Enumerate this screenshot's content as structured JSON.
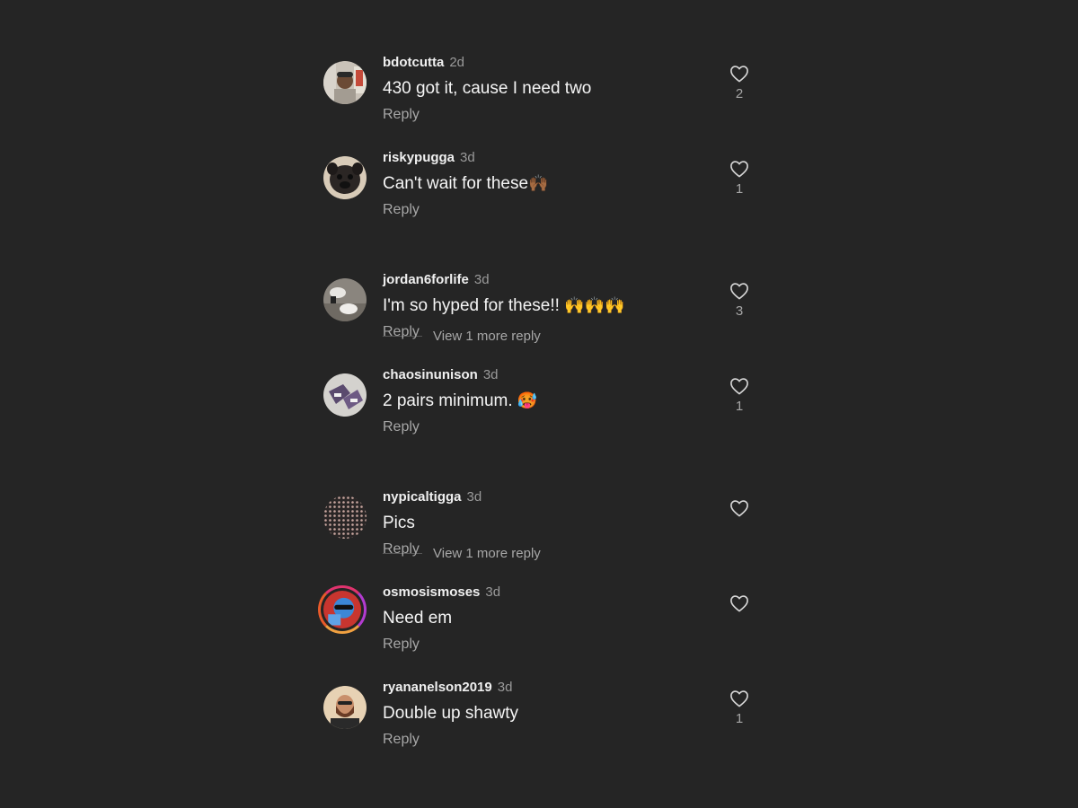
{
  "comments": [
    {
      "username": "bdotcutta",
      "time": "2d",
      "text": "430 got it, cause I need two",
      "reply": "Reply",
      "likes": "2"
    },
    {
      "username": "riskypugga",
      "time": "3d",
      "text": "Can't wait for these",
      "emoji": "🙌🏾",
      "reply": "Reply",
      "likes": "1",
      "more_replies": "View 1 more reply"
    },
    {
      "username": "jordan6forlife",
      "time": "3d",
      "text": "I'm so hyped for these!! ",
      "emoji": "🙌🙌🙌",
      "reply": "Reply",
      "likes": "3"
    },
    {
      "username": "chaosinunison",
      "time": "3d",
      "text": "2 pairs minimum. ",
      "emoji": "🥵",
      "reply": "Reply",
      "likes": "1",
      "more_replies": "View 1 more reply"
    },
    {
      "username": "nypicaltigga",
      "time": "3d",
      "text": "Pics",
      "reply": "Reply",
      "likes": ""
    },
    {
      "username": "osmosismoses",
      "time": "3d",
      "text": "Need em",
      "reply": "Reply",
      "likes": ""
    },
    {
      "username": "ryananelson2019",
      "time": "3d",
      "text": "Double up shawty",
      "reply": "Reply",
      "likes": "1"
    }
  ],
  "icons": {
    "like": "heart-outline-icon"
  },
  "colors": {
    "background": "#252525",
    "secondary_text": "#a7a7a7",
    "primary_text": "#f5f5f5"
  }
}
